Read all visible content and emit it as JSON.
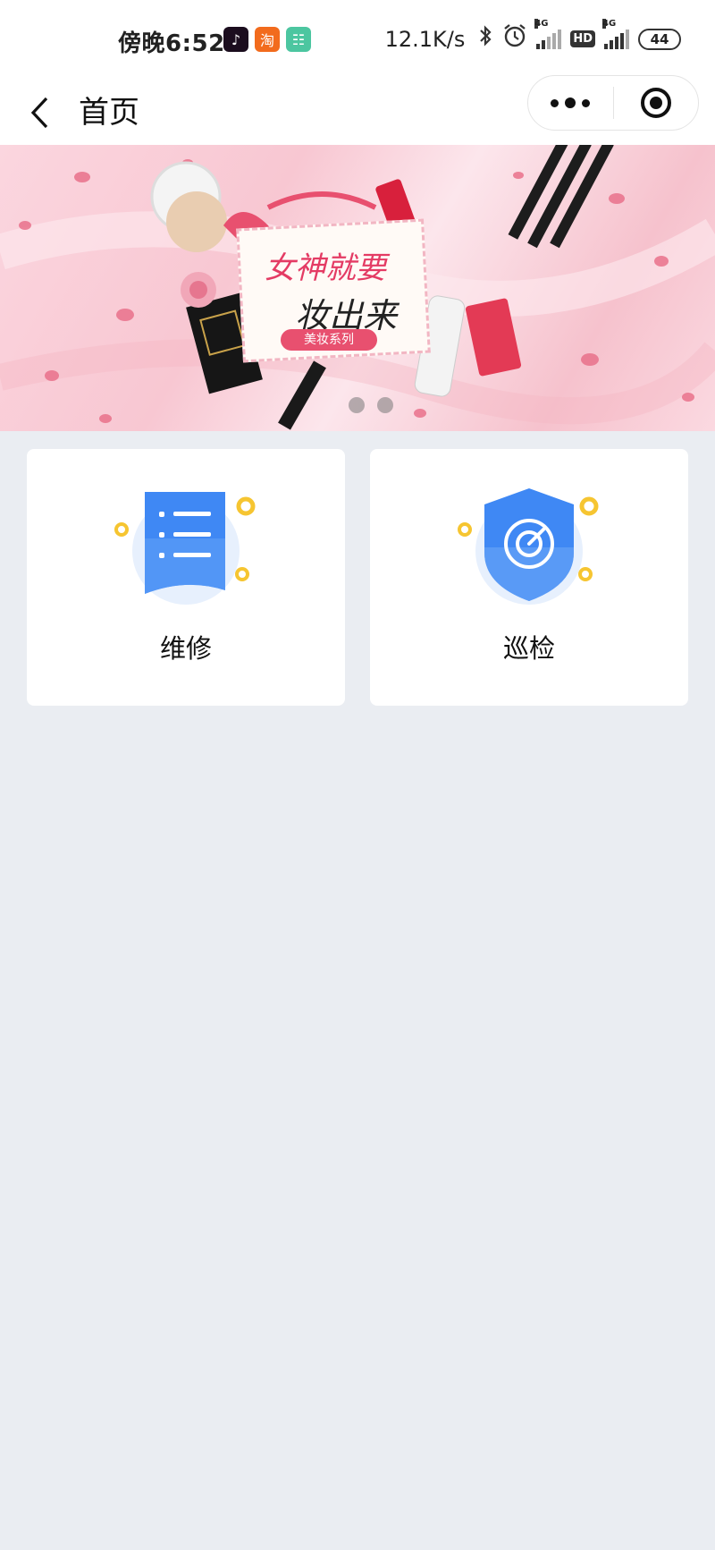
{
  "status_bar": {
    "time": "傍晚6:52",
    "network_speed": "12.1K/s",
    "signal1_label": "4G",
    "signal2_label": "4G",
    "hd_label": "HD",
    "battery": "44"
  },
  "nav": {
    "title": "首页"
  },
  "banner": {
    "headline_line1": "女神就要",
    "headline_line2": "妆出来",
    "tag": "美妆系列",
    "dots_count": 2
  },
  "cards": [
    {
      "label": "维修",
      "icon": "document-list-icon"
    },
    {
      "label": "巡检",
      "icon": "shield-target-icon"
    }
  ],
  "colors": {
    "accent_blue": "#3b82f6",
    "coin_yellow": "#f6c531",
    "page_background": "#eaedf2"
  }
}
